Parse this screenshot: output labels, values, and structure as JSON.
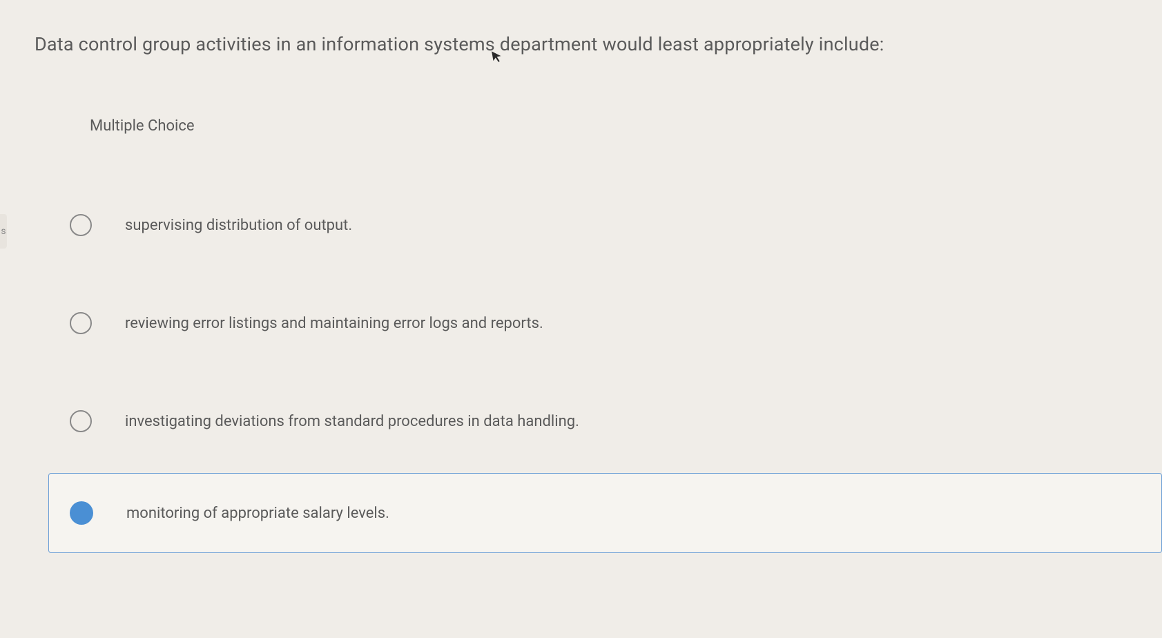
{
  "question": {
    "text": "Data control group activities in an information systems department would least appropriately include:"
  },
  "section_label": "Multiple Choice",
  "options": [
    {
      "text": "supervising distribution of output.",
      "selected": false
    },
    {
      "text": "reviewing error listings and maintaining error logs and reports.",
      "selected": false
    },
    {
      "text": "investigating deviations from standard procedures in data handling.",
      "selected": false
    },
    {
      "text": "monitoring of appropriate salary levels.",
      "selected": true
    }
  ],
  "left_tab_label": "s"
}
